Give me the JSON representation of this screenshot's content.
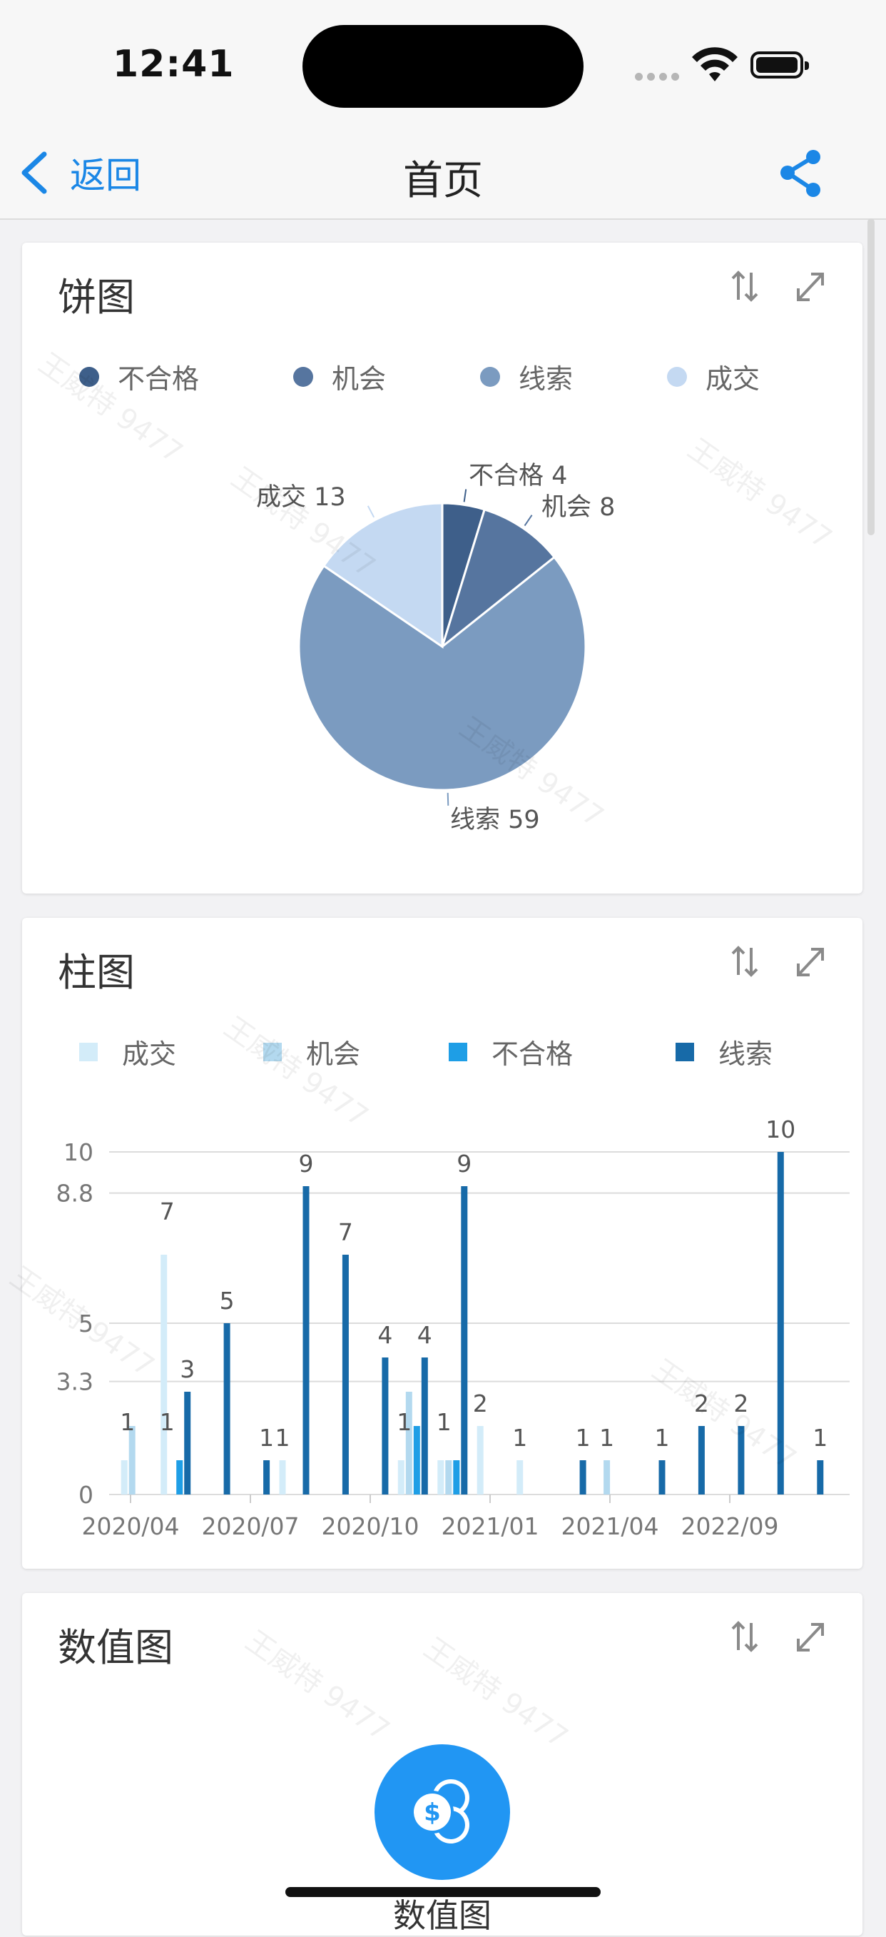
{
  "status_bar": {
    "time": "12:41"
  },
  "nav": {
    "back_label": "返回",
    "title": "首页"
  },
  "colors": {
    "accent": "#1b87e6"
  },
  "watermark_text": "王威特 9477",
  "pie_card": {
    "title": "饼图",
    "legend": [
      {
        "label": "不合格",
        "color": "#3e5f8a"
      },
      {
        "label": "机会",
        "color": "#56759f"
      },
      {
        "label": "线索",
        "color": "#7b9bc0"
      },
      {
        "label": "成交",
        "color": "#c4d9f2"
      }
    ],
    "labels": {
      "s0": "不合格  4",
      "s1": "机会  8",
      "s2": "线索  59",
      "s3": "成交  13"
    }
  },
  "bar_card": {
    "title": "柱图",
    "legend": [
      {
        "label": "成交",
        "color": "#d3ecf9"
      },
      {
        "label": "机会",
        "color": "#b3d9ef"
      },
      {
        "label": "不合格",
        "color": "#1e9ee6"
      },
      {
        "label": "线索",
        "color": "#176aa8"
      }
    ],
    "y_ticks": [
      "10",
      "8.8",
      "5",
      "3.3",
      "0"
    ],
    "x_ticks": [
      "2020/04",
      "2020/07",
      "2020/10",
      "2021/01",
      "2021/04",
      "2022/09"
    ]
  },
  "value_card": {
    "title": "数值图",
    "label": "数值图"
  },
  "chart_data": [
    {
      "type": "pie",
      "title": "饼图",
      "legend_placement": "top",
      "slices": [
        {
          "label": "不合格",
          "value": 4
        },
        {
          "label": "机会",
          "value": 8
        },
        {
          "label": "线索",
          "value": 59
        },
        {
          "label": "成交",
          "value": 13
        }
      ]
    },
    {
      "type": "bar",
      "title": "柱图",
      "legend_placement": "top",
      "grid": true,
      "ylim": [
        0,
        10
      ],
      "y_ticks": [
        0,
        3.3,
        5,
        8.8,
        10
      ],
      "x_ticks": [
        "2020/04",
        "2020/07",
        "2020/10",
        "2021/01",
        "2021/04",
        "2022/09"
      ],
      "bars": [
        {
          "group": 0,
          "series": "成交",
          "value": 1
        },
        {
          "group": 0,
          "series": "机会",
          "value": 2
        },
        {
          "group": 1,
          "series": "成交",
          "value": 7
        },
        {
          "group": 1,
          "series": "不合格",
          "value": 1
        },
        {
          "group": 1,
          "series": "线索",
          "value": 3,
          "label": "3"
        },
        {
          "group": 2,
          "series": "线索",
          "value": 5,
          "label": "5"
        },
        {
          "group": 3,
          "series": "线索",
          "value": 1,
          "label": "1"
        },
        {
          "group": 4,
          "series": "成交",
          "value": 1,
          "label": "1"
        },
        {
          "group": 4,
          "series": "线索",
          "value": 9,
          "label": "9"
        },
        {
          "group": 5,
          "series": "线索",
          "value": 7,
          "label": "7"
        },
        {
          "group": 6,
          "series": "线索",
          "value": 4,
          "label": "4"
        },
        {
          "group": 7,
          "series": "成交",
          "value": 1
        },
        {
          "group": 7,
          "series": "机会",
          "value": 3
        },
        {
          "group": 7,
          "series": "不合格",
          "value": 2
        },
        {
          "group": 7,
          "series": "线索",
          "value": 4,
          "label": "4"
        },
        {
          "group": 8,
          "series": "成交",
          "value": 1
        },
        {
          "group": 8,
          "series": "机会",
          "value": 1
        },
        {
          "group": 8,
          "series": "不合格",
          "value": 1
        },
        {
          "group": 8,
          "series": "线索",
          "value": 9,
          "label": "9"
        },
        {
          "group": 9,
          "series": "成交",
          "value": 2,
          "label": "2"
        },
        {
          "group": 10,
          "series": "成交",
          "value": 1,
          "label": "1"
        },
        {
          "group": 11,
          "series": "线索",
          "value": 1,
          "label": "1"
        },
        {
          "group": 12,
          "series": "机会",
          "value": 1,
          "label": "1"
        },
        {
          "group": 13,
          "series": "线索",
          "value": 1,
          "label": "1"
        },
        {
          "group": 14,
          "series": "线索",
          "value": 2,
          "label": "2"
        },
        {
          "group": 15,
          "series": "线索",
          "value": 2,
          "label": "2"
        },
        {
          "group": 16,
          "series": "线索",
          "value": 10,
          "label": "10"
        },
        {
          "group": 17,
          "series": "线索",
          "value": 1,
          "label": "1"
        }
      ],
      "extra_labels": [
        {
          "group": 0,
          "text": "1"
        },
        {
          "group": 1,
          "text": "7"
        },
        {
          "group": 1,
          "text": "1"
        },
        {
          "group": 7,
          "text": "1"
        },
        {
          "group": 8,
          "text": "1"
        }
      ]
    }
  ]
}
